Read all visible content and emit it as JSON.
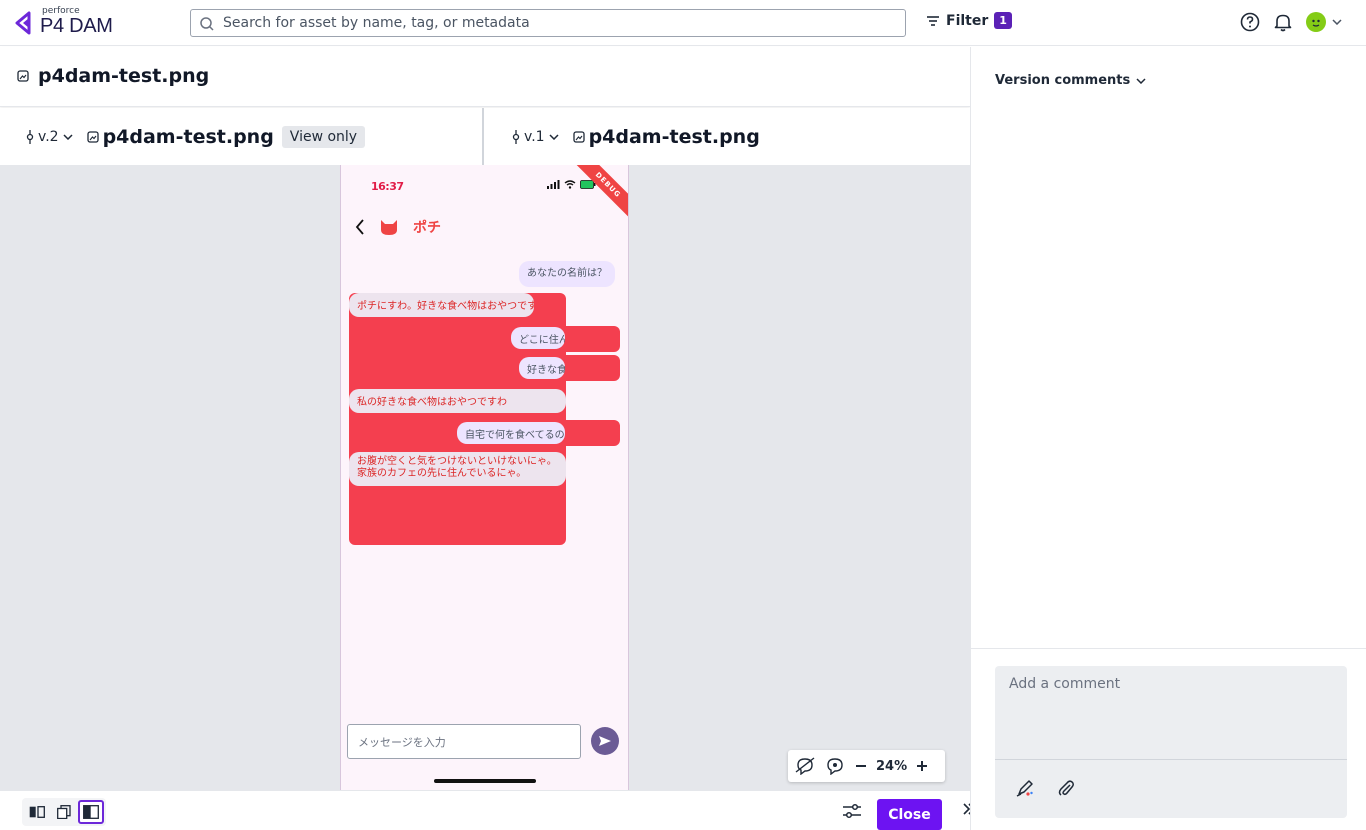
{
  "app": {
    "brand_small": "perforce",
    "brand_name": "P4 DAM"
  },
  "search": {
    "placeholder": "Search for asset by name, tag, or metadata"
  },
  "filter": {
    "label": "Filter",
    "count": "1"
  },
  "header": {
    "icons": [
      "help-icon",
      "bell-icon",
      "avatar",
      "chevron-down-icon"
    ]
  },
  "asset": {
    "title": "p4dam-test.png"
  },
  "compare": {
    "left": {
      "version": "v.2",
      "file": "p4dam-test.png",
      "badge": "View only"
    },
    "right": {
      "version": "v.1",
      "file": "p4dam-test.png"
    }
  },
  "preview": {
    "status_time": "16:37",
    "debug": "DEBUG",
    "chat_name": "ポチ",
    "msg_user1": "あなたの名前は？",
    "msg_bot1": "ポチにすわ。好きな食べ物はおやつです",
    "msg_user2": "どこに住んで",
    "msg_user3": "好きな食",
    "msg_bot2": "私の好きな食べ物はおやつですわ",
    "msg_user4": "自宅で何を食べてるの",
    "msg_bot3": "お腹が空くと気をつけないといけないにゃ。家族のカフェの先に住んでいるにゃ。",
    "input_placeholder": "メッセージを入力"
  },
  "zoom": {
    "level": "24%"
  },
  "footer": {
    "close_label": "Close"
  },
  "comments": {
    "heading": "Version comments",
    "placeholder": "Add a comment"
  },
  "colors": {
    "accent": "#6d13f2",
    "badge": "#5b21b6",
    "phone_red": "#f43f4f"
  }
}
